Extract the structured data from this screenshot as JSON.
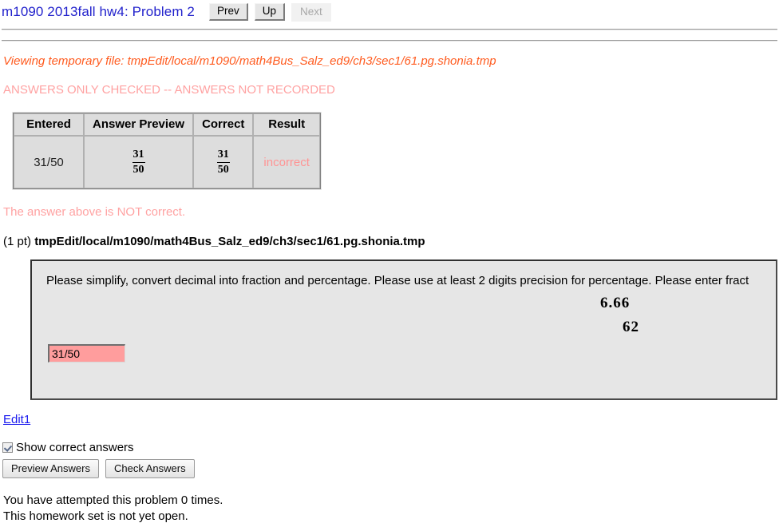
{
  "header": {
    "problem_title": "m1090 2013fall hw4: Problem 2",
    "nav": {
      "prev_label": "Prev",
      "up_label": "Up",
      "next_label": "Next"
    }
  },
  "notices": {
    "temp_file": "Viewing temporary file: tmpEdit/local/m1090/math4Bus_Salz_ed9/ch3/sec1/61.pg.shonia.tmp",
    "answers_checked": "ANSWERS ONLY CHECKED -- ANSWERS NOT RECORDED",
    "not_correct": "The answer above is NOT correct."
  },
  "results_table": {
    "columns": [
      "Entered",
      "Answer Preview",
      "Correct",
      "Result"
    ],
    "row": {
      "entered": "31/50",
      "preview_numerator": "31",
      "preview_denominator": "50",
      "correct_numerator": "31",
      "correct_denominator": "50",
      "result": "incorrect"
    }
  },
  "problem_header": {
    "points": "(1 pt)",
    "path": "tmpEdit/local/m1090/math4Bus_Salz_ed9/ch3/sec1/61.pg.shonia.tmp"
  },
  "problem_box": {
    "statement": "Please simplify, convert decimal into fraction and percentage. Please use at least 2 digits precision for percentage. Please enter fract",
    "math_line_1": "6.66",
    "math_line_2": "62",
    "answer_value": "31/50"
  },
  "footer": {
    "edit_link": "Edit1",
    "show_correct_answers_label": "Show correct answers",
    "show_correct_answers_checked": true,
    "preview_answers_label": "Preview Answers",
    "check_answers_label": "Check Answers",
    "attempts_line": "You have attempted this problem 0 times.",
    "homework_status_line": "This homework set is not yet open."
  },
  "colors": {
    "title_blue": "#2222cc",
    "temp_notice_orange": "#ff5b1f",
    "incorrect_pink": "#ff9494",
    "notice_pink": "#ffa2a2",
    "input_error_bg": "#ff9d9d",
    "link_blue": "#1a1aee"
  }
}
